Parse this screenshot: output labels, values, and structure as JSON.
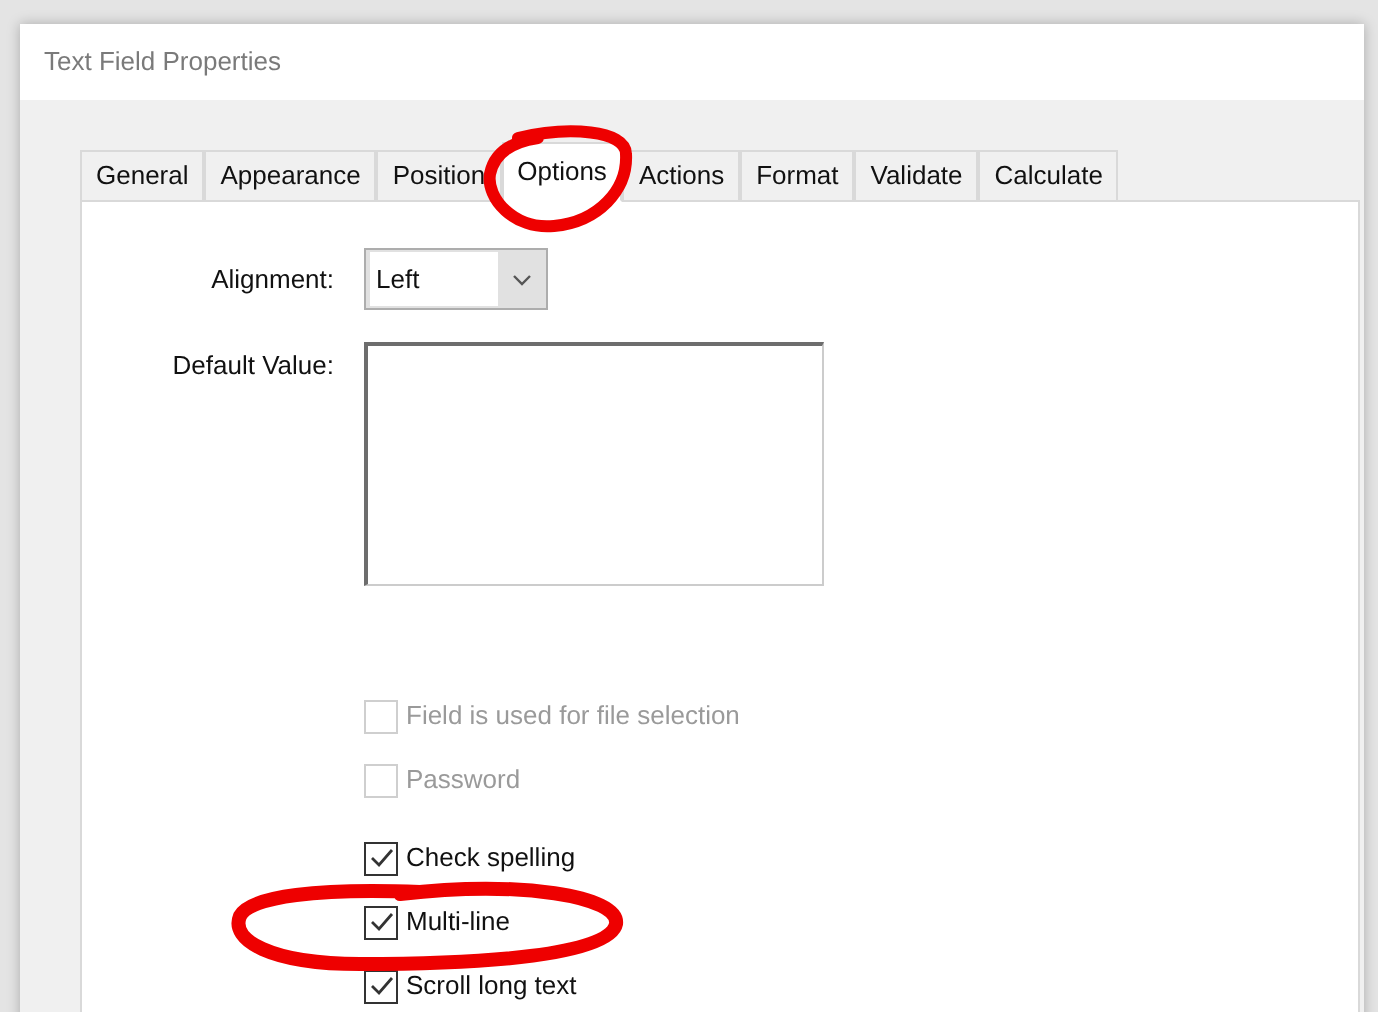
{
  "window": {
    "title": "Text Field Properties"
  },
  "tabs": [
    {
      "label": "General",
      "selected": false
    },
    {
      "label": "Appearance",
      "selected": false
    },
    {
      "label": "Position",
      "selected": false
    },
    {
      "label": "Options",
      "selected": true
    },
    {
      "label": "Actions",
      "selected": false
    },
    {
      "label": "Format",
      "selected": false
    },
    {
      "label": "Validate",
      "selected": false
    },
    {
      "label": "Calculate",
      "selected": false
    }
  ],
  "alignment": {
    "label": "Alignment:",
    "value": "Left"
  },
  "default_value": {
    "label": "Default Value:"
  },
  "checkboxes": [
    {
      "label": "Field is used for file selection",
      "checked": false,
      "disabled": true
    },
    {
      "label": "Password",
      "checked": false,
      "disabled": true
    },
    {
      "label": "Check spelling",
      "checked": true,
      "disabled": false
    },
    {
      "label": "Multi-line",
      "checked": true,
      "disabled": false
    },
    {
      "label": "Scroll long text",
      "checked": true,
      "disabled": false
    }
  ]
}
